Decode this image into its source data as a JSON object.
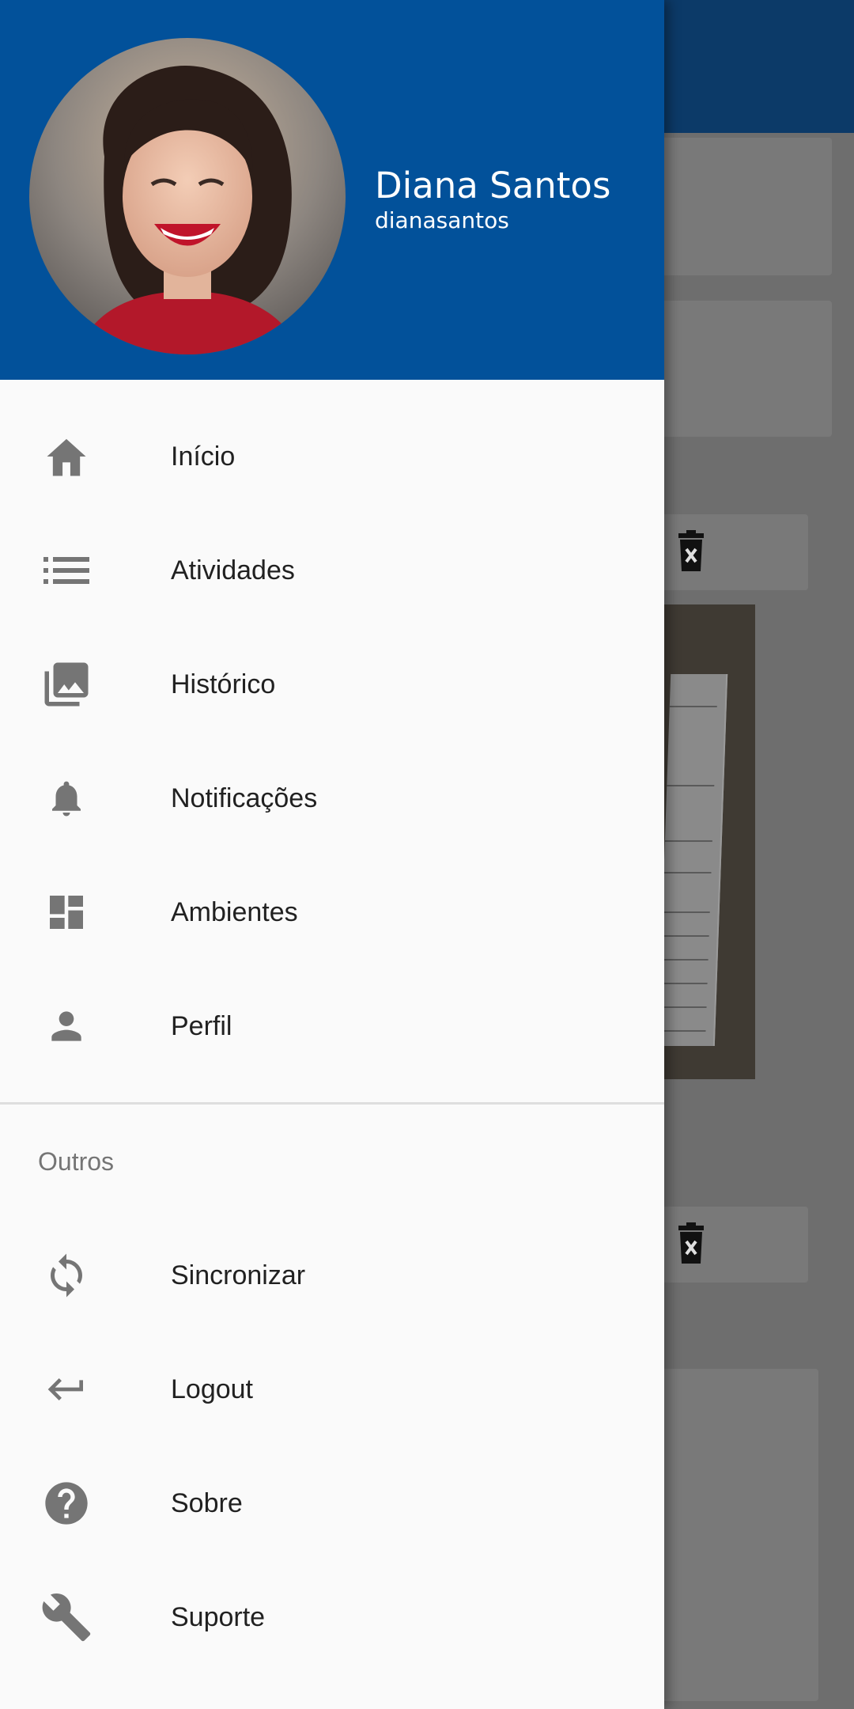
{
  "drawer": {
    "user": {
      "name": "Diana Santos",
      "handle": "dianasantos"
    },
    "primary_items": [
      {
        "label": "Início",
        "icon": "home-icon"
      },
      {
        "label": "Atividades",
        "icon": "list-icon"
      },
      {
        "label": "Histórico",
        "icon": "photo-library-icon"
      },
      {
        "label": "Notificações",
        "icon": "bell-icon"
      },
      {
        "label": "Ambientes",
        "icon": "dashboard-icon"
      },
      {
        "label": "Perfil",
        "icon": "person-icon"
      }
    ],
    "section_title": "Outros",
    "secondary_items": [
      {
        "label": "Sincronizar",
        "icon": "sync-icon"
      },
      {
        "label": "Logout",
        "icon": "return-arrow-icon"
      },
      {
        "label": "Sobre",
        "icon": "help-icon"
      },
      {
        "label": "Suporte",
        "icon": "wrench-icon"
      }
    ]
  },
  "colors": {
    "header_bg": "#02519a",
    "icon_gray": "#757575",
    "drawer_bg": "#fafafa",
    "scrim_appbar": "#0c3a68"
  }
}
